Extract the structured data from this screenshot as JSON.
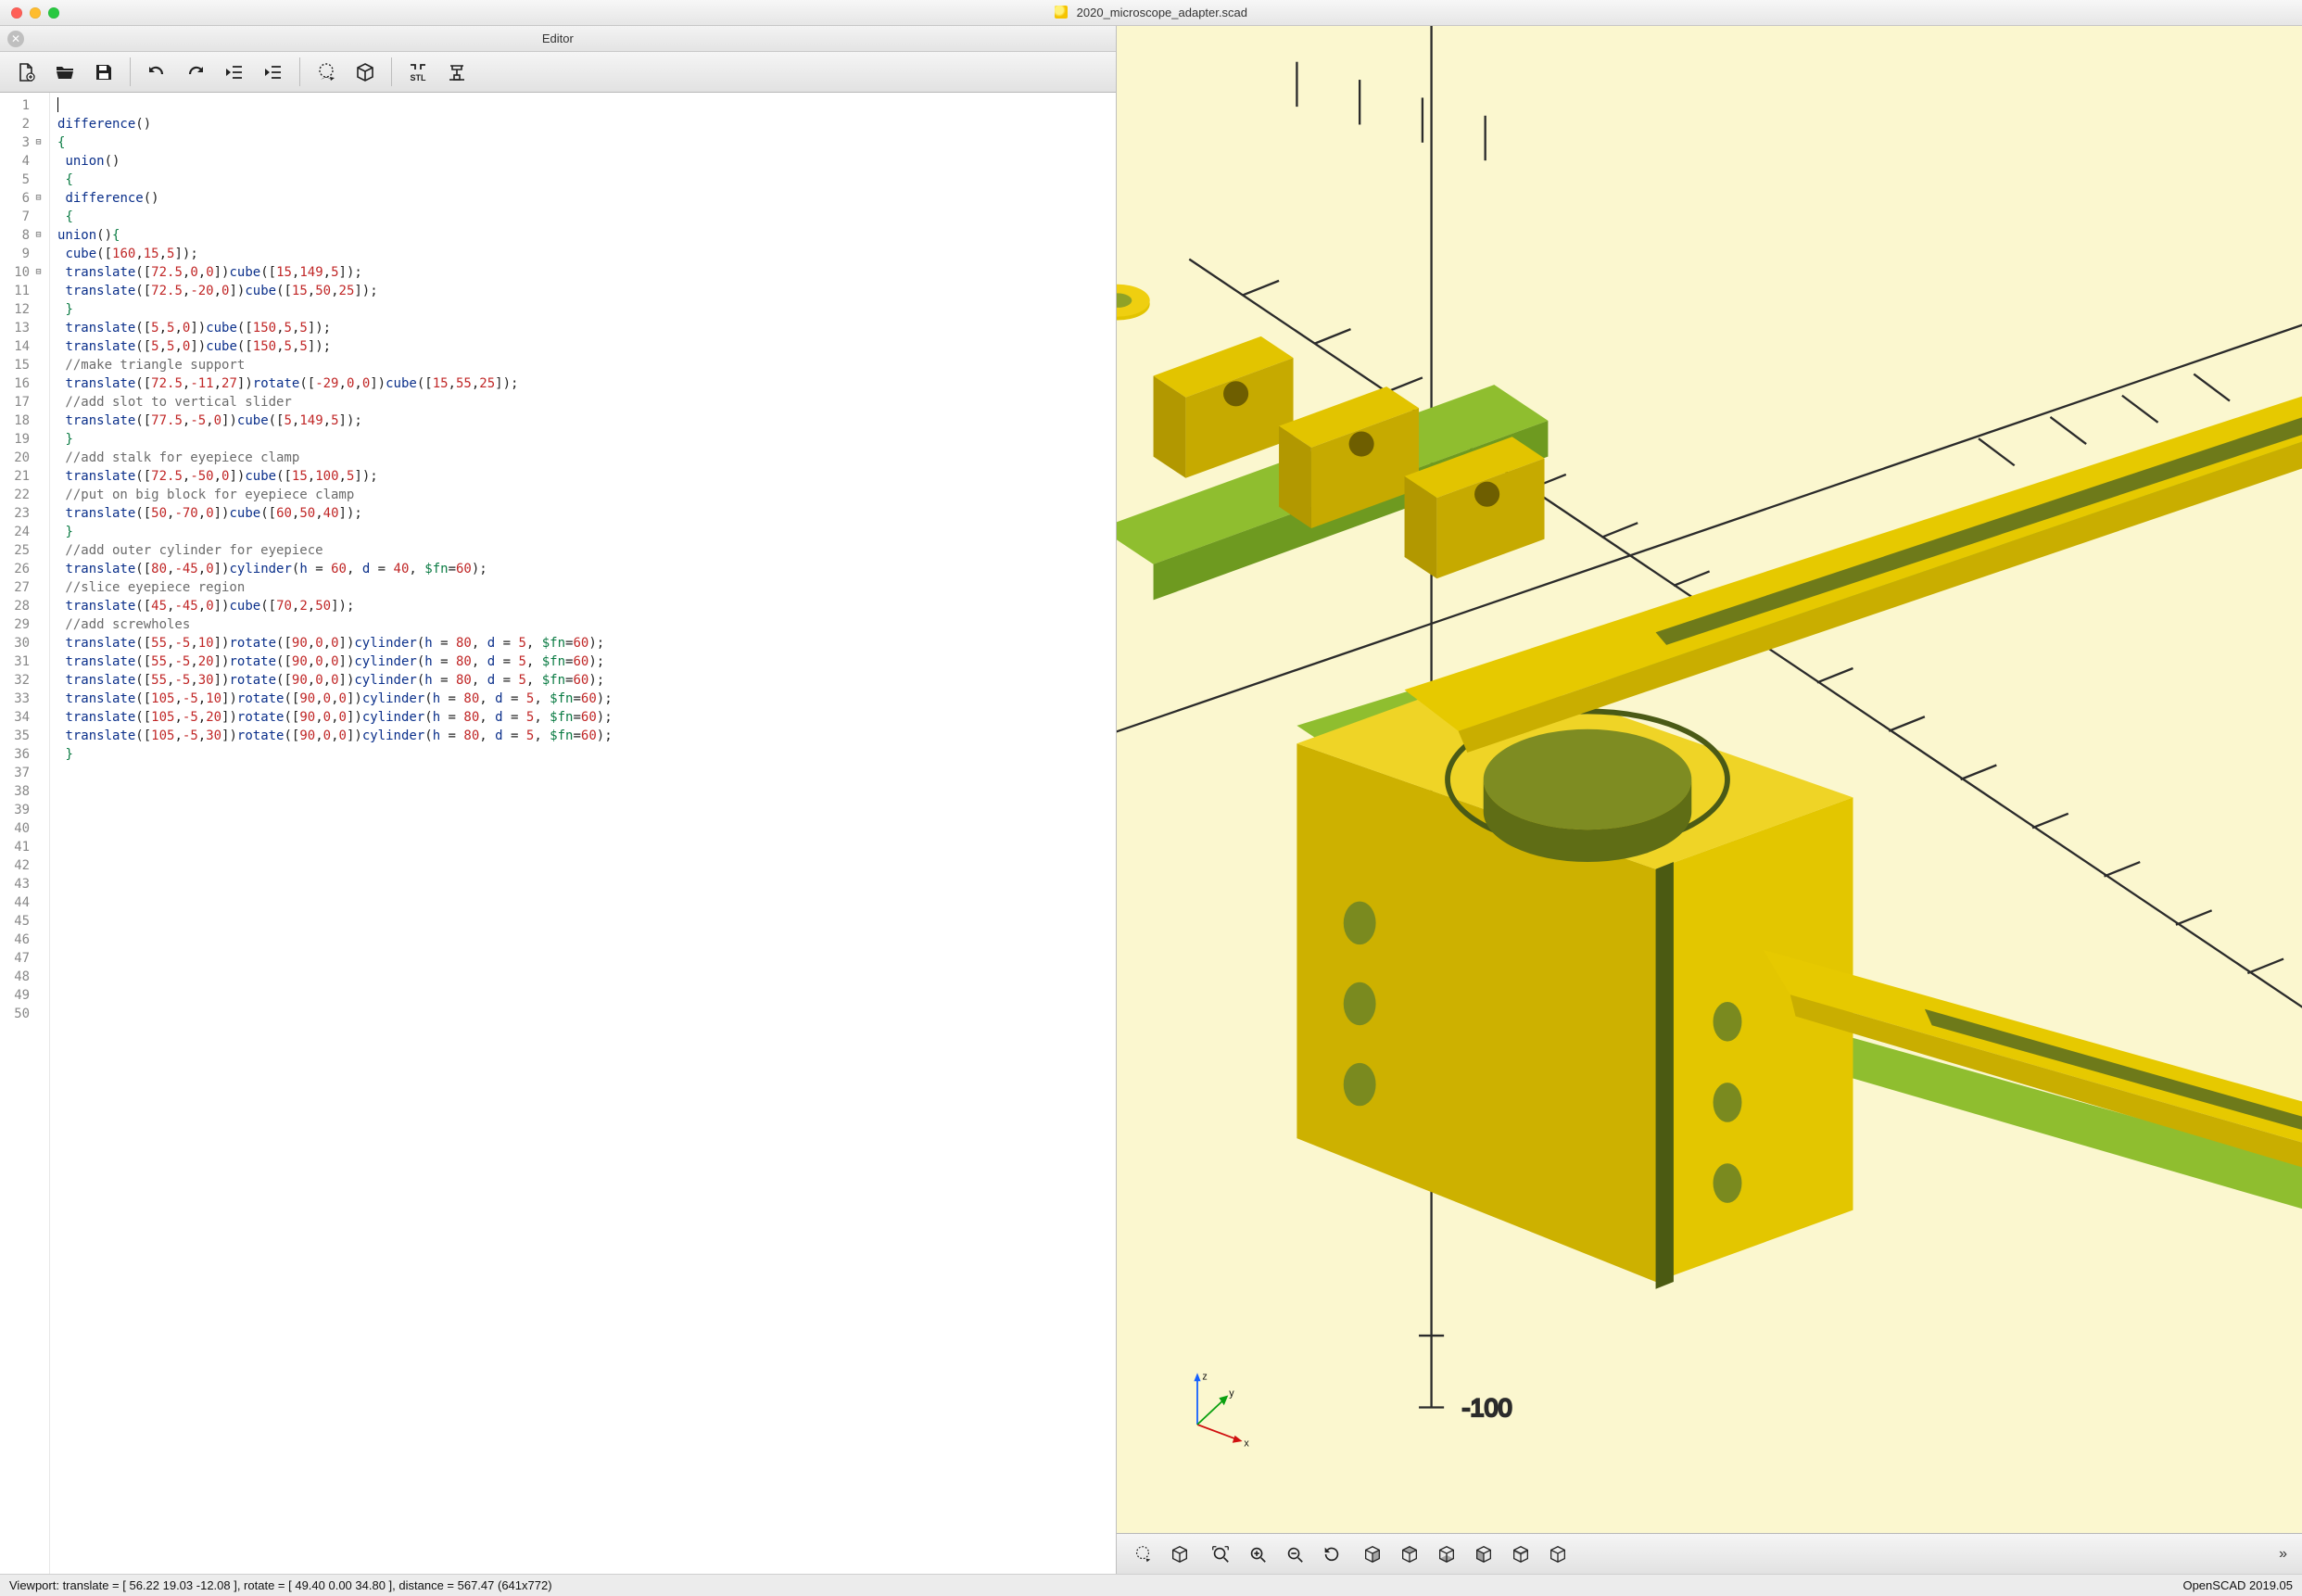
{
  "window": {
    "title": "2020_microscope_adapter.scad",
    "editor_pane_title": "Editor"
  },
  "editor_toolbar": {
    "new": "New",
    "open": "Open",
    "save": "Save",
    "undo": "Undo",
    "redo": "Redo",
    "unindent": "Unindent",
    "indent": "Indent",
    "preview": "Preview",
    "render": "Render",
    "export_stl": "STL",
    "send_to_print": "Send to Printer"
  },
  "viewer_toolbar": {
    "preview": "Preview",
    "render": "Render",
    "zoom_fit": "View All",
    "zoom_in": "Zoom In",
    "zoom_out": "Zoom Out",
    "reset": "Reset View",
    "right": "Right",
    "top": "Top",
    "bottom": "Bottom",
    "left": "Left",
    "front": "Front",
    "back": "Back",
    "more": "»"
  },
  "code": {
    "cursor_line": 1,
    "fold_markers": {
      "3": "⊟",
      "6": "⊟",
      "8": "⊟",
      "10": "⊟"
    },
    "lines": [
      "",
      "difference()",
      "{",
      "",
      " union()",
      " {",
      " difference()",
      " {",
      "",
      "union(){",
      " cube([160,15,5]);",
      " translate([72.5,0,0])cube([15,149,5]);",
      " translate([72.5,-20,0])cube([15,50,25]);",
      "",
      " }",
      "",
      " translate([5,5,0])cube([150,5,5]);",
      " translate([5,5,0])cube([150,5,5]);",
      "",
      " //make triangle support",
      " translate([72.5,-11,27])rotate([-29,0,0])cube([15,55,25]);",
      "",
      " //add slot to vertical slider",
      " translate([77.5,-5,0])cube([5,149,5]);",
      "",
      " }",
      "",
      " //add stalk for eyepiece clamp",
      " translate([72.5,-50,0])cube([15,100,5]);",
      "",
      " //put on big block for eyepiece clamp",
      " translate([50,-70,0])cube([60,50,40]);",
      " }",
      "",
      "",
      " //add outer cylinder for eyepiece",
      " translate([80,-45,0])cylinder(h = 60, d = 40, $fn=60);",
      "",
      " //slice eyepiece region",
      " translate([45,-45,0])cube([70,2,50]);",
      "",
      " //add screwholes",
      " translate([55,-5,10])rotate([90,0,0])cylinder(h = 80, d = 5, $fn=60);",
      " translate([55,-5,20])rotate([90,0,0])cylinder(h = 80, d = 5, $fn=60);",
      " translate([55,-5,30])rotate([90,0,0])cylinder(h = 80, d = 5, $fn=60);",
      " translate([105,-5,10])rotate([90,0,0])cylinder(h = 80, d = 5, $fn=60);",
      " translate([105,-5,20])rotate([90,0,0])cylinder(h = 80, d = 5, $fn=60);",
      " translate([105,-5,30])rotate([90,0,0])cylinder(h = 80, d = 5, $fn=60);",
      "",
      " }"
    ]
  },
  "status": {
    "viewport_text": "Viewport: translate = [ 56.22 19.03 -12.08 ], rotate = [ 49.40 0.00 34.80 ], distance = 567.47 (641x772)",
    "version": "OpenSCAD 2019.05"
  },
  "axes": {
    "x": "x",
    "y": "y",
    "z": "z"
  }
}
